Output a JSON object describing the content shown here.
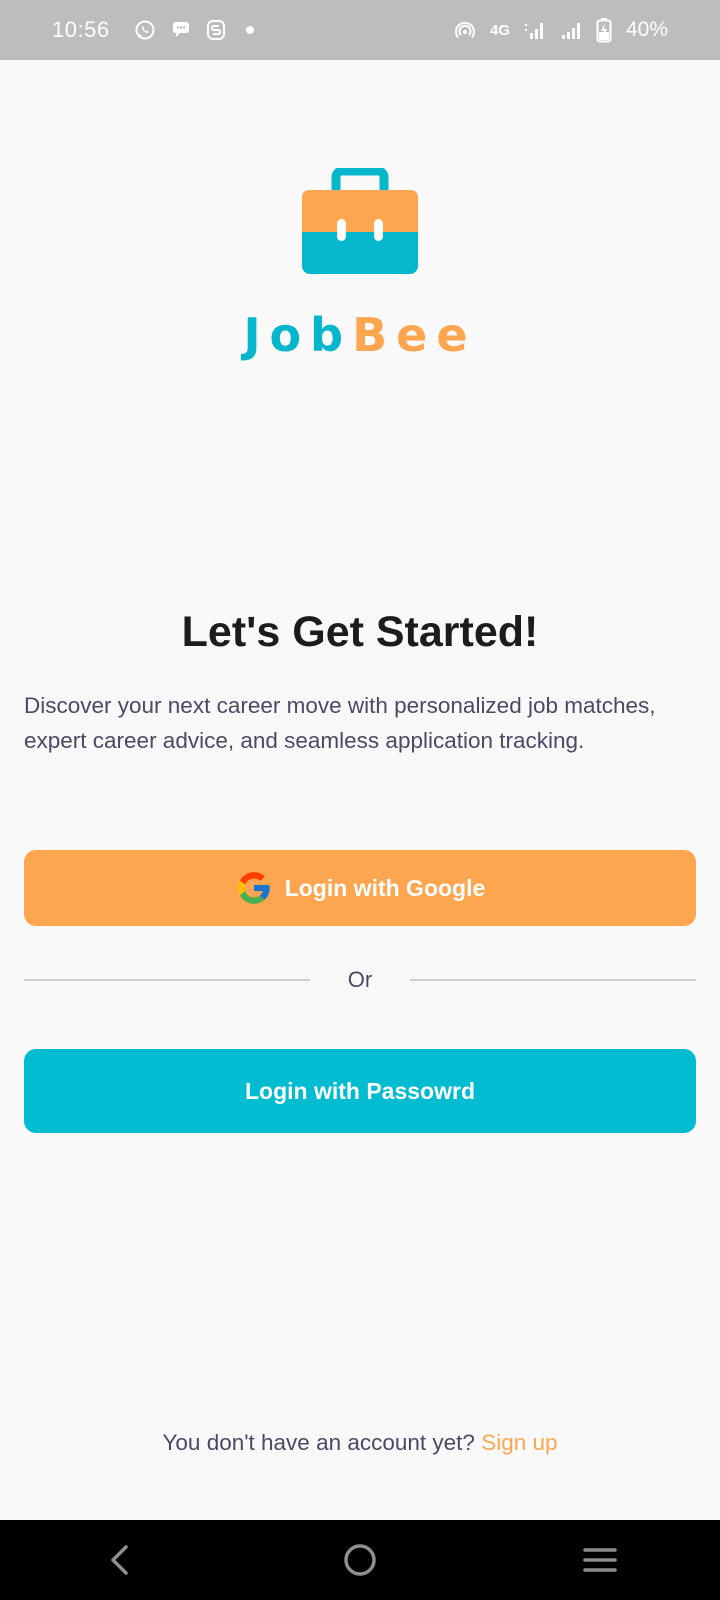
{
  "status_bar": {
    "time": "10:56",
    "network": "4G",
    "battery": "40%",
    "icons": [
      "whatsapp-icon",
      "chat-bubble-icon",
      "s-app-icon",
      "notification-dot",
      "hotspot-icon",
      "signal-icon",
      "signal-icon",
      "battery-charging-icon"
    ]
  },
  "logo": {
    "name_part1": "Job",
    "name_part2": "Bee",
    "colors": {
      "teal": "#06b6cd",
      "orange": "#fda54f"
    }
  },
  "main": {
    "headline": "Let's Get Started!",
    "description": "Discover your next career move with personalized job matches, expert career advice, and seamless application tracking.",
    "google_button_label": "Login with Google",
    "divider_text": "Or",
    "password_button_label": "Login with Passowrd",
    "signup_prompt": "You don't have an account yet?",
    "signup_link": "Sign up"
  },
  "nav_bar": {
    "buttons": [
      "back",
      "home",
      "recents"
    ]
  },
  "colors": {
    "accent_orange": "#fda54f",
    "accent_teal": "#00bcd0",
    "text_dark": "#1c1c1e",
    "text_muted": "#4b4a63"
  }
}
